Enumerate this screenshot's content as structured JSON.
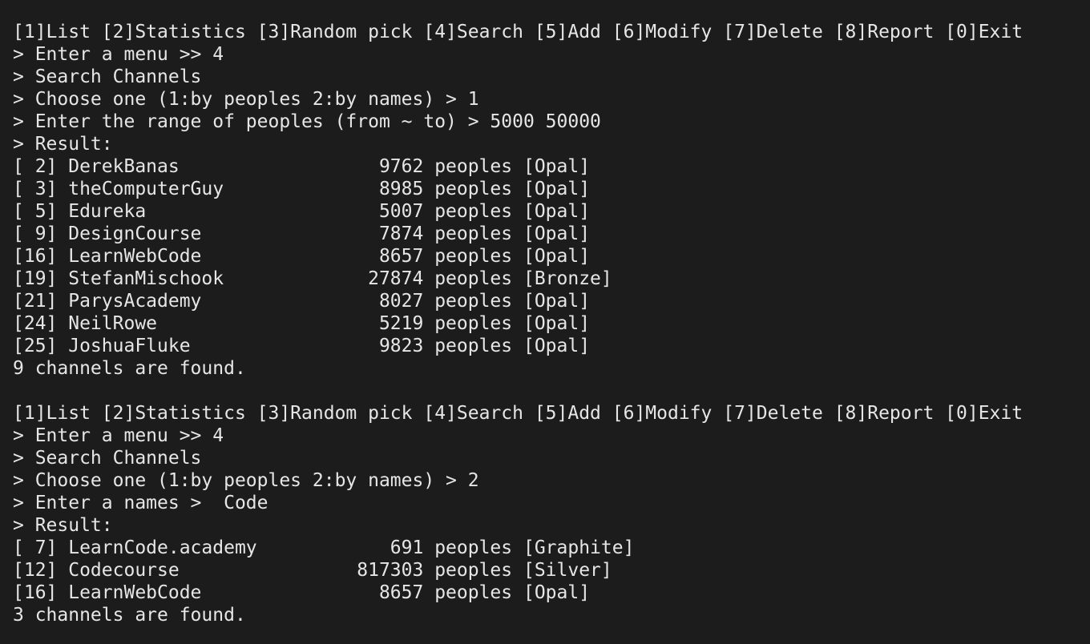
{
  "terminal": {
    "lines": [
      "[1]List [2]Statistics [3]Random pick [4]Search [5]Add [6]Modify [7]Delete [8]Report [0]Exit",
      "> Enter a menu >> 4",
      "> Search Channels",
      "> Choose one (1:by peoples 2:by names) > 1",
      "> Enter the range of peoples (from ~ to) > 5000 50000",
      "> Result:",
      "[ 2] DerekBanas                  9762 peoples [Opal]",
      "[ 3] theComputerGuy              8985 peoples [Opal]",
      "[ 5] Edureka                     5007 peoples [Opal]",
      "[ 9] DesignCourse                7874 peoples [Opal]",
      "[16] LearnWebCode                8657 peoples [Opal]",
      "[19] StefanMischook             27874 peoples [Bronze]",
      "[21] ParysAcademy                8027 peoples [Opal]",
      "[24] NeilRowe                    5219 peoples [Opal]",
      "[25] JoshuaFluke                 9823 peoples [Opal]",
      "9 channels are found.",
      "",
      "[1]List [2]Statistics [3]Random pick [4]Search [5]Add [6]Modify [7]Delete [8]Report [0]Exit",
      "> Enter a menu >> 4",
      "> Search Channels",
      "> Choose one (1:by peoples 2:by names) > 2",
      "> Enter a names >  Code",
      "> Result:",
      "[ 7] LearnCode.academy            691 peoples [Graphite]",
      "[12] Codecourse                817303 peoples [Silver]",
      "[16] LearnWebCode                8657 peoples [Opal]",
      "3 channels are found."
    ]
  }
}
